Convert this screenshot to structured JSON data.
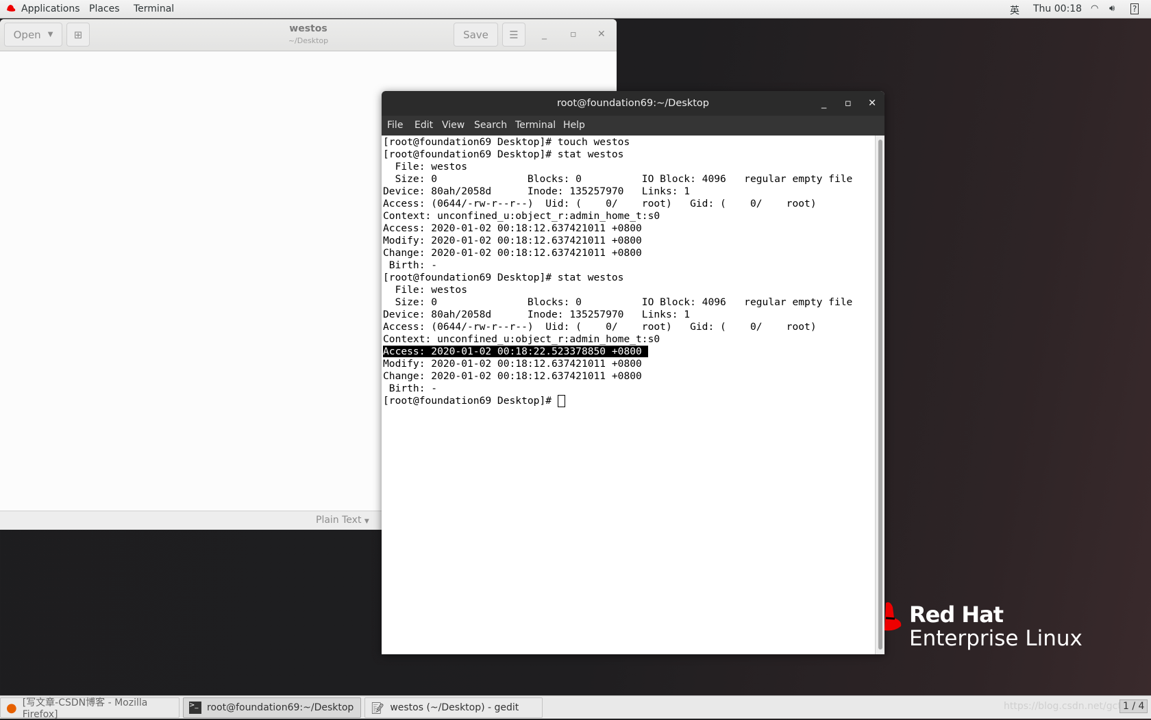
{
  "topbar": {
    "applications": "Applications",
    "places": "Places",
    "terminal": "Terminal",
    "input_method": "英",
    "clock": "Thu 00:18"
  },
  "gedit": {
    "open_label": "Open",
    "title": "westos",
    "subtitle": "~/Desktop",
    "save_label": "Save",
    "language": "Plain Text"
  },
  "terminal": {
    "title": "root@foundation69:~/Desktop",
    "menu": [
      "File",
      "Edit",
      "View",
      "Search",
      "Terminal",
      "Help"
    ],
    "lines": [
      "[root@foundation69 Desktop]# touch westos",
      "[root@foundation69 Desktop]# stat westos",
      "  File: westos",
      "  Size: 0               Blocks: 0          IO Block: 4096   regular empty file",
      "Device: 80ah/2058d      Inode: 135257970   Links: 1",
      "Access: (0644/-rw-r--r--)  Uid: (    0/    root)   Gid: (    0/    root)",
      "Context: unconfined_u:object_r:admin_home_t:s0",
      "Access: 2020-01-02 00:18:12.637421011 +0800",
      "Modify: 2020-01-02 00:18:12.637421011 +0800",
      "Change: 2020-01-02 00:18:12.637421011 +0800",
      " Birth: -",
      "[root@foundation69 Desktop]# stat westos",
      "  File: westos",
      "  Size: 0               Blocks: 0          IO Block: 4096   regular empty file",
      "Device: 80ah/2058d      Inode: 135257970   Links: 1",
      "Access: (0644/-rw-r--r--)  Uid: (    0/    root)   Gid: (    0/    root)",
      "Context: unconfined_u:object_r:admin_home_t:s0",
      "Access: 2020-01-02 00:18:22.523378850 +0800 ",
      "Modify: 2020-01-02 00:18:12.637421011 +0800",
      "Change: 2020-01-02 00:18:12.637421011 +0800",
      " Birth: -",
      "[root@foundation69 Desktop]# "
    ]
  },
  "desktop": {
    "logo_line1": "Red Hat",
    "logo_line2": "Enterprise Linux"
  },
  "taskbar": {
    "items": [
      "[写文章-CSDN博客 - Mozilla Firefox]",
      "root@foundation69:~/Desktop",
      "westos (~/Desktop) - gedit"
    ],
    "workspace": "1 / 4",
    "watermark": "https://blog.csdn.net/gcto"
  }
}
